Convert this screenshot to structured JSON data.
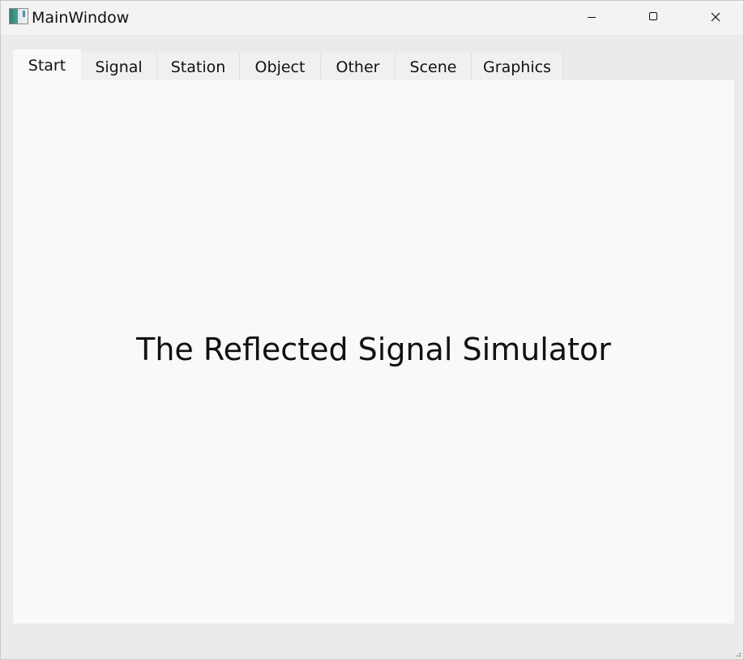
{
  "window": {
    "title": "MainWindow",
    "icon": "app-window-icon",
    "controls": {
      "minimize_icon": "minimize-icon",
      "maximize_icon": "maximize-icon",
      "close_icon": "close-icon"
    }
  },
  "tabs": [
    {
      "label": "Start",
      "active": true
    },
    {
      "label": "Signal",
      "active": false
    },
    {
      "label": "Station",
      "active": false
    },
    {
      "label": "Object",
      "active": false
    },
    {
      "label": "Other",
      "active": false
    },
    {
      "label": "Scene",
      "active": false
    },
    {
      "label": "Graphics",
      "active": false
    }
  ],
  "main": {
    "heading": "The Reflected Signal Simulator"
  },
  "colors": {
    "window_bg": "#ebebeb",
    "content_bg": "#f9f9f9",
    "tab_bg": "#f0f0f0",
    "text": "#111111"
  }
}
